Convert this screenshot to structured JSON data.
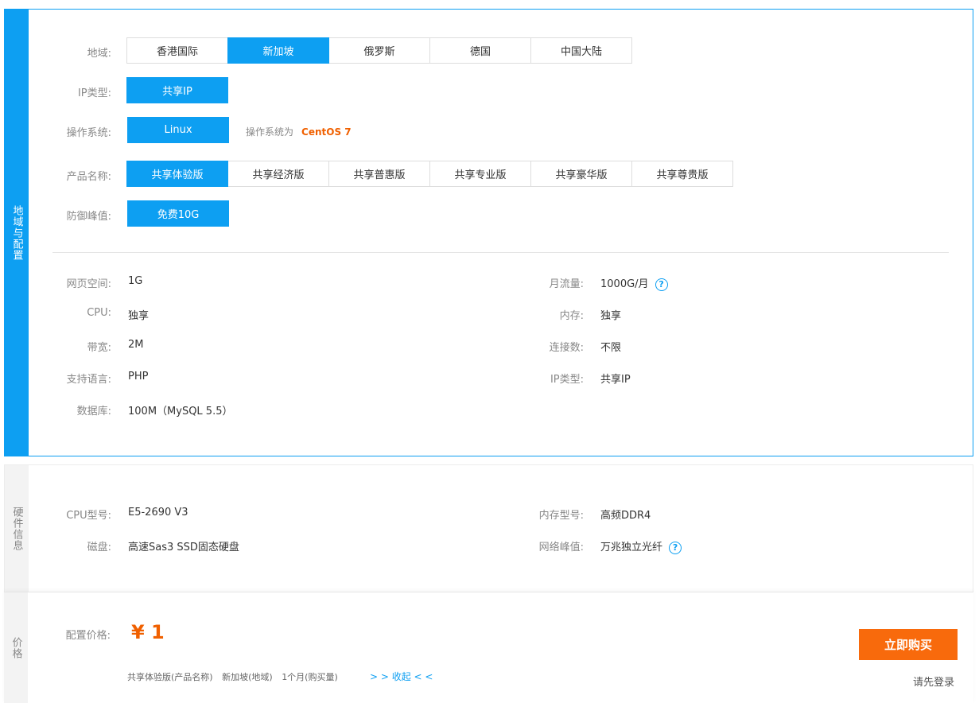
{
  "region_panel": {
    "side_label": "地域与配置",
    "region": {
      "label": "地域:",
      "options": [
        "香港国际",
        "新加坡",
        "俄罗斯",
        "德国",
        "中国大陆"
      ],
      "selected": "新加坡"
    },
    "ip_type": {
      "label": "IP类型:",
      "options": [
        "共享IP"
      ],
      "selected": "共享IP"
    },
    "os": {
      "label": "操作系统:",
      "options": [
        "Linux"
      ],
      "selected": "Linux",
      "note": "操作系统为",
      "note_value": "CentOS 7"
    },
    "product": {
      "label": "产品名称:",
      "options": [
        "共享体验版",
        "共享经济版",
        "共享普惠版",
        "共享专业版",
        "共享豪华版",
        "共享尊贵版"
      ],
      "selected": "共享体验版"
    },
    "defense": {
      "label": "防御峰值:",
      "options": [
        "免费10G"
      ],
      "selected": "免费10G"
    },
    "specs_left": [
      {
        "label": "网页空间:",
        "value": "1G"
      },
      {
        "label": "CPU:",
        "value": "独享"
      },
      {
        "label": "带宽:",
        "value": "2M"
      },
      {
        "label": "支持语言:",
        "value": "PHP"
      },
      {
        "label": "数据库:",
        "value": "100M（MySQL 5.5）"
      }
    ],
    "specs_right": [
      {
        "label": "月流量:",
        "value": "1000G/月",
        "help": true
      },
      {
        "label": "内存:",
        "value": "独享"
      },
      {
        "label": "连接数:",
        "value": "不限"
      },
      {
        "label": "IP类型:",
        "value": "共享IP"
      }
    ]
  },
  "hardware_panel": {
    "side_label": "硬件信息",
    "left": [
      {
        "label": "CPU型号:",
        "value": "E5-2690 V3"
      },
      {
        "label": "磁盘:",
        "value": "高速Sas3 SSD固态硬盘"
      }
    ],
    "right": [
      {
        "label": "内存型号:",
        "value": "高频DDR4"
      },
      {
        "label": "网络峰值:",
        "value": "万兆独立光纤",
        "help": true
      }
    ]
  },
  "price_panel": {
    "side_label": "价格",
    "label": "配置价格:",
    "price": "¥ 1",
    "summary": [
      "共享体验版(产品名称)",
      "新加坡(地域)",
      "1个月(购买量)"
    ],
    "toggle": "> > 收起 < <",
    "buy_button": "立即购买",
    "login": "请先登录"
  },
  "icons": {
    "help": "question-circle-icon"
  },
  "colors": {
    "accent": "#0d9ff2",
    "price": "#f06000",
    "buy": "#f86a0c"
  }
}
